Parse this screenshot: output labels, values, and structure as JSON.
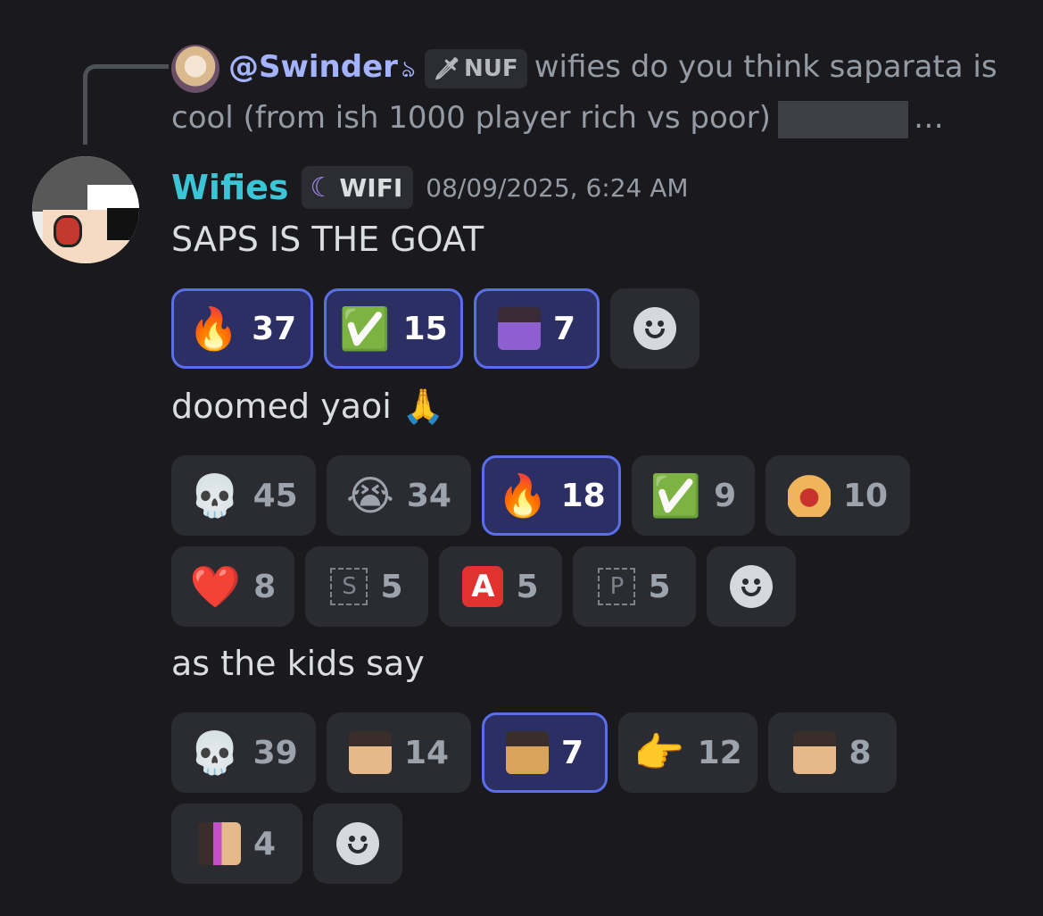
{
  "reply": {
    "author": "@Swinder",
    "author_icon": "heart-tail-icon",
    "tag_icon": "sword-icon",
    "tag": "NUF",
    "text": "wifies do you think saparata is cool (from ish 1000 player  rich vs poor)",
    "ellipsis": "…"
  },
  "message": {
    "author": "Wifies",
    "author_color": "#3bc6d8",
    "role_icon": "moon-icon",
    "role_tag": "WIFI",
    "timestamp": "08/09/2025, 6:24 AM",
    "lines": [
      {
        "text": "SAPS IS THE GOAT",
        "reactions": [
          {
            "emoji": "🔥",
            "count": "37",
            "me": true
          },
          {
            "emoji": "✅",
            "count": "15",
            "me": true
          },
          {
            "emoji": "custom-devil-sticker",
            "count": "7",
            "me": true
          }
        ]
      },
      {
        "text": "doomed yaoi",
        "inline_emoji": "🙏",
        "reactions": [
          {
            "emoji": "💀",
            "count": "45",
            "me": false
          },
          {
            "emoji": "😭",
            "count": "34",
            "me": false
          },
          {
            "emoji": "🔥",
            "count": "18",
            "me": true
          },
          {
            "emoji": "✅",
            "count": "9",
            "me": false
          },
          {
            "emoji": "custom-screaming-sticker",
            "count": "10",
            "me": false
          },
          {
            "emoji": "❤️",
            "count": "8",
            "me": false
          },
          {
            "emoji": "S",
            "count": "5",
            "me": false
          },
          {
            "emoji": "A",
            "count": "5",
            "me": false
          },
          {
            "emoji": "P",
            "count": "5",
            "me": false
          }
        ]
      },
      {
        "text": "as the kids say",
        "reactions": [
          {
            "emoji": "💀",
            "count": "39",
            "me": false
          },
          {
            "emoji": "custom-nerd-sticker",
            "count": "14",
            "me": false
          },
          {
            "emoji": "custom-doge-sticker",
            "count": "7",
            "me": true
          },
          {
            "emoji": "👉",
            "count": "12",
            "me": false
          },
          {
            "emoji": "custom-face-sticker",
            "count": "8",
            "me": false
          },
          {
            "emoji": "custom-side-face-sticker",
            "count": "4",
            "me": false
          }
        ]
      }
    ]
  },
  "colors": {
    "background": "#1a1a1e",
    "reaction_bg": "#2b2c31",
    "reaction_me_bg": "#2b2f63",
    "reaction_me_border": "#5b6eea",
    "reply_name": "#a4b3ff"
  }
}
